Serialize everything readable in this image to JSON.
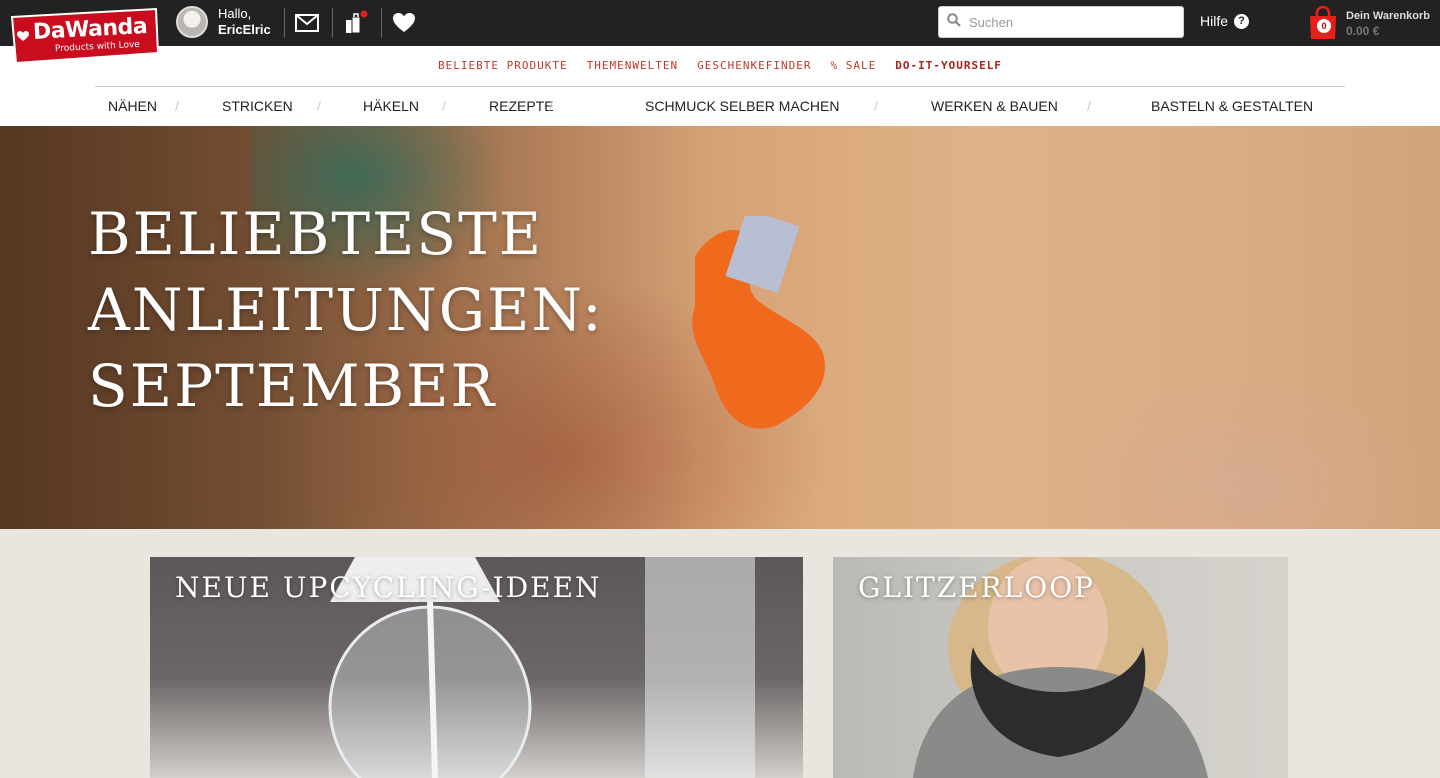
{
  "brand": {
    "name": "DaWanda",
    "tagline": "Products with Love",
    "color": "#d0021b"
  },
  "user": {
    "greeting": "Hallo,",
    "name": "EricElric"
  },
  "header": {
    "search_placeholder": "Suchen",
    "help_label": "Hilfe",
    "help_icon": "?",
    "cart_label": "Dein Warenkorb",
    "cart_amount": "0.00 €",
    "cart_count": "0"
  },
  "categories": [
    "BELIEBTE PRODUKTE",
    "THEMENWELTEN",
    "GESCHENKEFINDER",
    "% SALE",
    "DO-IT-YOURSELF"
  ],
  "diy_nav": [
    "NÄHEN",
    "STRICKEN",
    "HÄKELN",
    "REZEPTE",
    "SCHMUCK SELBER MACHEN",
    "WERKEN & BAUEN",
    "BASTELN & GESTALTEN"
  ],
  "hero": {
    "line1": "BELIEBTESTE",
    "line2": "ANLEITUNGEN:",
    "line3": "SEPTEMBER"
  },
  "tiles": [
    {
      "title": "NEUE UPCYCLING-IDEEN"
    },
    {
      "title": "GLITZERLOOP"
    }
  ]
}
